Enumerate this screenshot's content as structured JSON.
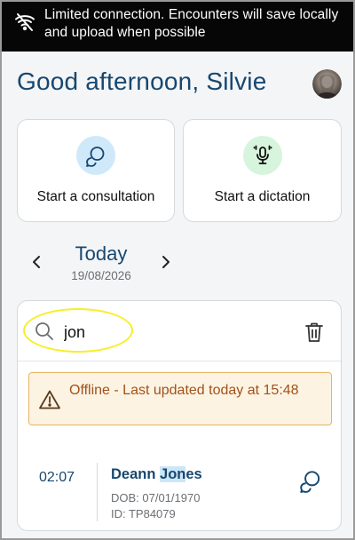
{
  "banner": {
    "icon": "wifi-off-icon",
    "message": "Limited connection. Encounters will save locally and upload when possible"
  },
  "header": {
    "greeting": "Good afternoon, Silvie",
    "avatar": "user-avatar"
  },
  "actions": [
    {
      "label": "Start a consultation",
      "icon": "chat-bubbles-icon",
      "color": "#cfe9fb"
    },
    {
      "label": "Start a dictation",
      "icon": "microphone-icon",
      "color": "#d7f4dc"
    }
  ],
  "date_nav": {
    "title": "Today",
    "date": "19/08/2026"
  },
  "search": {
    "value": "jon",
    "placeholder": ""
  },
  "offline_alert": {
    "text": "Offline - Last updated today at 15:48",
    "icon": "warning-icon"
  },
  "encounters": [
    {
      "time": "02:07",
      "name_pre": "Deann ",
      "name_match": "Jon",
      "name_post": "es",
      "dob": "DOB: 07/01/1970",
      "id": "ID: TP84079"
    }
  ],
  "colors": {
    "primary": "#17476f",
    "banner_bg": "#060606",
    "warning_text": "#a0521d",
    "warning_bg": "#fdf3e2",
    "search_highlight": "#f6ef2a"
  }
}
